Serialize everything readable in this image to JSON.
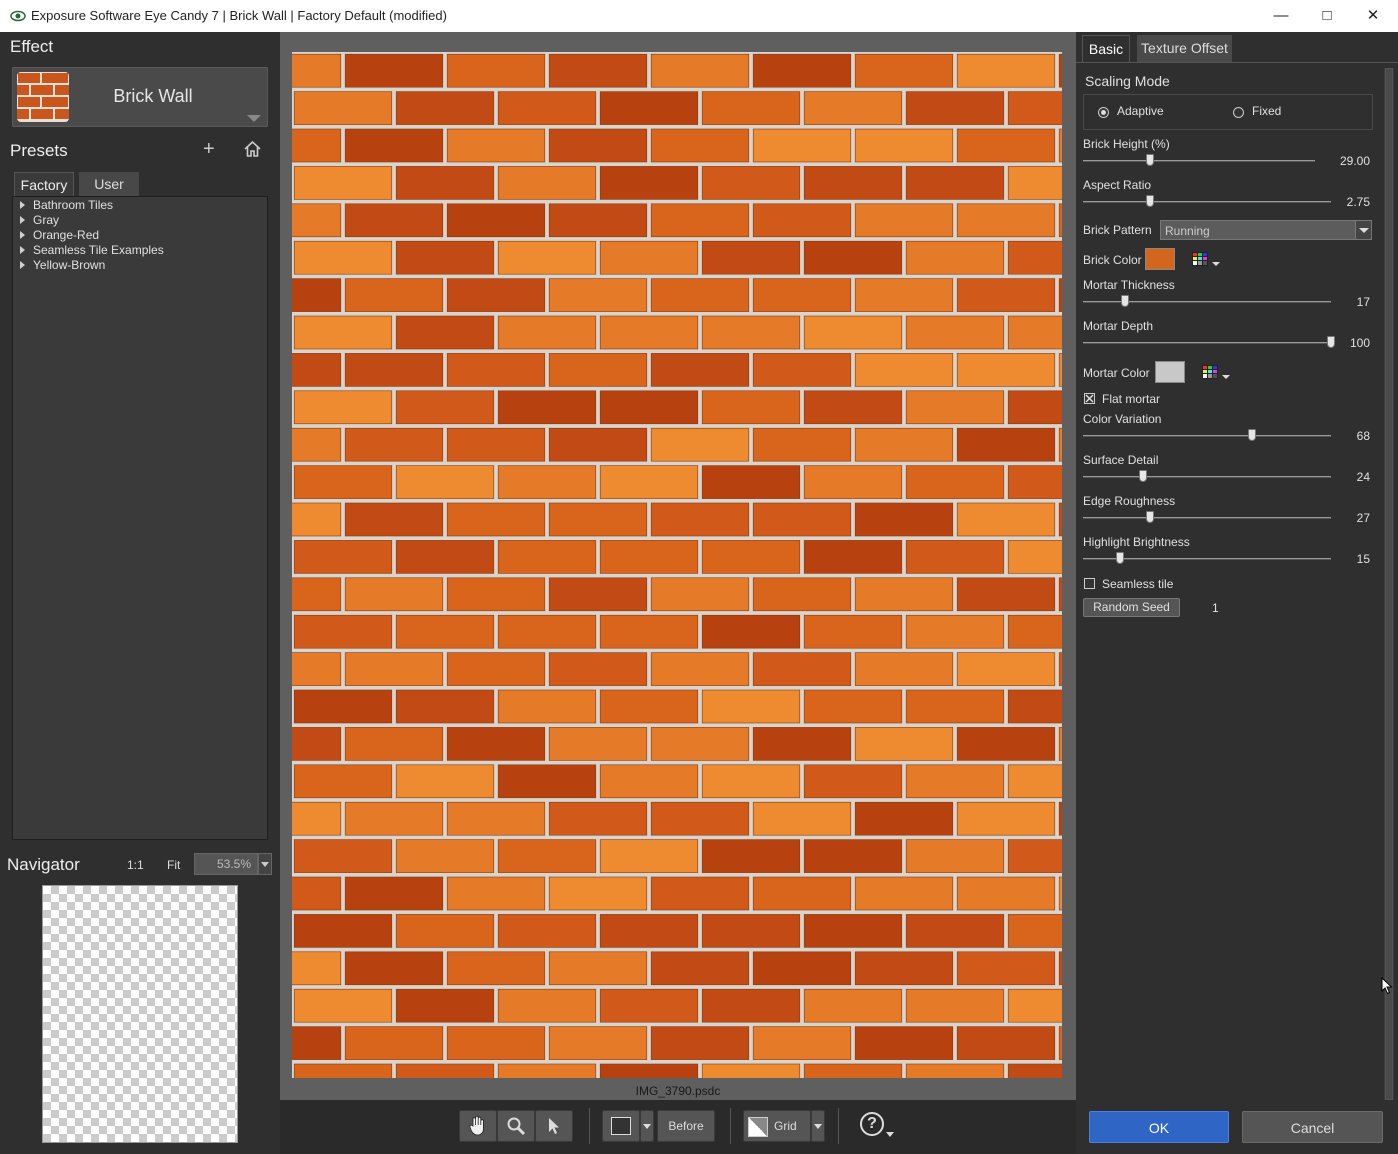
{
  "window": {
    "title": "Exposure Software Eye Candy 7 | Brick Wall | Factory Default (modified)",
    "controls": [
      "minimize",
      "maximize",
      "close"
    ]
  },
  "effect": {
    "header": "Effect",
    "name": "Brick Wall",
    "thumbnail_icon": "brick-wall-thumbnail"
  },
  "presets": {
    "header": "Presets",
    "tabs": [
      "Factory",
      "User"
    ],
    "active_tab": "Factory",
    "tree": [
      "Bathroom Tiles",
      "Gray",
      "Orange-Red",
      "Seamless Tile Examples",
      "Yellow-Brown"
    ]
  },
  "navigator": {
    "header": "Navigator",
    "one_to_one": "1:1",
    "fit": "Fit",
    "zoom": "53.5%"
  },
  "preview": {
    "filename": "IMG_3790.psdc",
    "brick_colors": [
      "#d9651d",
      "#c24b15",
      "#e57a28",
      "#b8420f",
      "#d15a1a",
      "#ee8a30"
    ],
    "mortar_color": "#d9d4cc"
  },
  "toolbar": {
    "before_label": "Before",
    "grid_label": "Grid",
    "help_icon": "question-icon"
  },
  "settings": {
    "tabs": [
      "Basic",
      "Texture Offset"
    ],
    "active_tab": "Basic",
    "scaling_mode": {
      "label": "Scaling Mode",
      "options": [
        "Adaptive",
        "Fixed"
      ],
      "selected": "Adaptive"
    },
    "brick_height": {
      "label": "Brick Height (%)",
      "value": "29.00",
      "fraction": 0.29
    },
    "aspect_ratio": {
      "label": "Aspect Ratio",
      "value": "2.75",
      "fraction": 0.27
    },
    "brick_pattern": {
      "label": "Brick Pattern",
      "value": "Running"
    },
    "brick_color": {
      "label": "Brick Color",
      "color": "#d2661c"
    },
    "mortar_thickness": {
      "label": "Mortar Thickness",
      "value": "17",
      "fraction": 0.17
    },
    "mortar_depth": {
      "label": "Mortar Depth",
      "value": "100",
      "fraction": 1.0
    },
    "mortar_color": {
      "label": "Mortar Color",
      "color": "#c8c8c8"
    },
    "flat_mortar": {
      "label": "Flat mortar",
      "checked": true
    },
    "color_variation": {
      "label": "Color Variation",
      "value": "68",
      "fraction": 0.68
    },
    "surface_detail": {
      "label": "Surface Detail",
      "value": "24",
      "fraction": 0.24
    },
    "edge_roughness": {
      "label": "Edge Roughness",
      "value": "27",
      "fraction": 0.27
    },
    "highlight_brightness": {
      "label": "Highlight Brightness",
      "value": "15",
      "fraction": 0.15
    },
    "seamless_tile": {
      "label": "Seamless tile",
      "checked": false
    },
    "random_seed": {
      "button": "Random Seed",
      "value": "1"
    }
  },
  "buttons": {
    "ok": "OK",
    "cancel": "Cancel"
  }
}
